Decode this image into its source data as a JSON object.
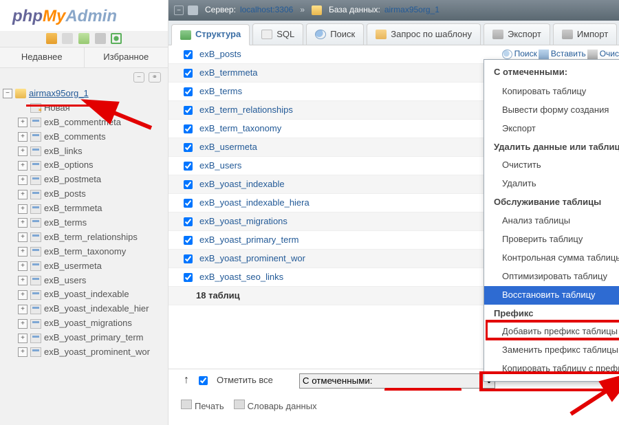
{
  "logo": {
    "p1": "php",
    "p2": "My",
    "p3": "Admin"
  },
  "left": {
    "recent": "Недавнее",
    "favorite": "Избранное",
    "db": "airmax95org_1",
    "new": "Новая",
    "tables": [
      "exB_commentmeta",
      "exB_comments",
      "exB_links",
      "exB_options",
      "exB_postmeta",
      "exB_posts",
      "exB_termmeta",
      "exB_terms",
      "exB_term_relationships",
      "exB_term_taxonomy",
      "exB_usermeta",
      "exB_users",
      "exB_yoast_indexable",
      "exB_yoast_indexable_hier",
      "exB_yoast_migrations",
      "exB_yoast_primary_term",
      "exB_yoast_prominent_wor"
    ]
  },
  "breadcrumb": {
    "server_lbl": "Сервер:",
    "server_val": "localhost:3306",
    "db_lbl": "База данных:",
    "db_val": "airmax95org_1"
  },
  "tabs": {
    "structure": "Структура",
    "sql": "SQL",
    "search": "Поиск",
    "query": "Запрос по шаблону",
    "export": "Экспорт",
    "import": "Импорт"
  },
  "tables": [
    "exB_posts",
    "exB_termmeta",
    "exB_terms",
    "exB_term_relationships",
    "exB_term_taxonomy",
    "exB_usermeta",
    "exB_users",
    "exB_yoast_indexable",
    "exB_yoast_indexable_hiera",
    "exB_yoast_migrations",
    "exB_yoast_primary_term",
    "exB_yoast_prominent_wor",
    "exB_yoast_seo_links"
  ],
  "summary": "18 таблиц",
  "actions": {
    "search": "Поиск",
    "insert": "Вставить",
    "empty": "Очис"
  },
  "checkall": {
    "arrow": "↳",
    "label": "Отметить все"
  },
  "select_placeholder": "С отмеченными:",
  "print": "Печать",
  "dict": "Словарь данных",
  "menu": {
    "header": "С отмеченными:",
    "items": [
      {
        "t": "Копировать таблицу"
      },
      {
        "t": "Вывести форму создания"
      },
      {
        "t": "Экспорт"
      },
      {
        "t": "Удалить данные или таблицу",
        "bold": true
      },
      {
        "t": "Очистить",
        "indent": true
      },
      {
        "t": "Удалить",
        "indent": true
      },
      {
        "t": "Обслуживание таблицы",
        "bold": true
      },
      {
        "t": "Анализ таблицы",
        "indent": true
      },
      {
        "t": "Проверить таблицу",
        "indent": true
      },
      {
        "t": "Контрольная сумма таблицы",
        "indent": true
      },
      {
        "t": "Оптимизировать таблицу",
        "indent": true
      },
      {
        "t": "Восстановить таблицу",
        "indent": true,
        "hl": true
      },
      {
        "t": "Префикс",
        "bold": true
      },
      {
        "t": "Добавить префикс таблицы",
        "indent": true
      },
      {
        "t": "Заменить префикс таблицы",
        "indent": true
      },
      {
        "t": "Копировать таблицу с префиксом",
        "indent": true
      }
    ]
  }
}
